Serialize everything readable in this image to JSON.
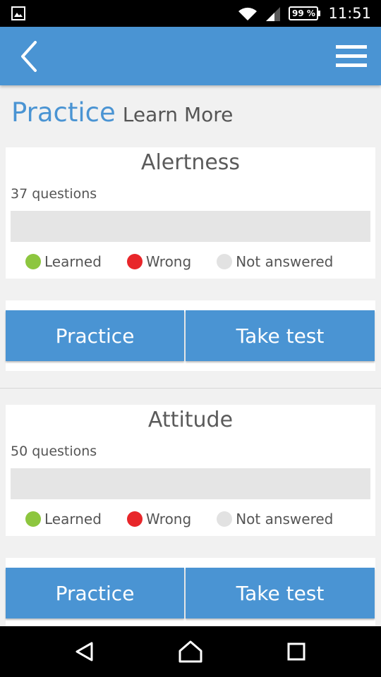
{
  "status_bar": {
    "battery": "99 %",
    "time": "11:51",
    "icons": [
      "image-notification-icon",
      "wifi-icon",
      "signal-icon",
      "battery-icon"
    ]
  },
  "app_bar": {
    "icons": [
      "back-arrow-icon",
      "hamburger-menu-icon"
    ]
  },
  "header": {
    "title": "Practice",
    "link": "Learn More"
  },
  "sections": [
    {
      "title": "Alertness",
      "count": "37 questions",
      "progress_learned": 0,
      "legend": {
        "learned": "Learned",
        "wrong": "Wrong",
        "not_answered": "Not answered"
      },
      "buttons": {
        "practice": "Practice",
        "test": "Take test"
      }
    },
    {
      "title": "Attitude",
      "count": "50 questions",
      "progress_learned": 0,
      "legend": {
        "learned": "Learned",
        "wrong": "Wrong",
        "not_answered": "Not answered"
      },
      "buttons": {
        "practice": "Practice",
        "test": "Take test"
      }
    }
  ],
  "colors": {
    "accent": "#4a94d3",
    "learned": "#8dc63f",
    "wrong": "#e8262a",
    "not_answered": "#e2e2e2",
    "progress_track": "#e5e5e5"
  },
  "nav_bar": {
    "icons": [
      "back-triangle-icon",
      "home-icon",
      "recents-icon"
    ]
  }
}
